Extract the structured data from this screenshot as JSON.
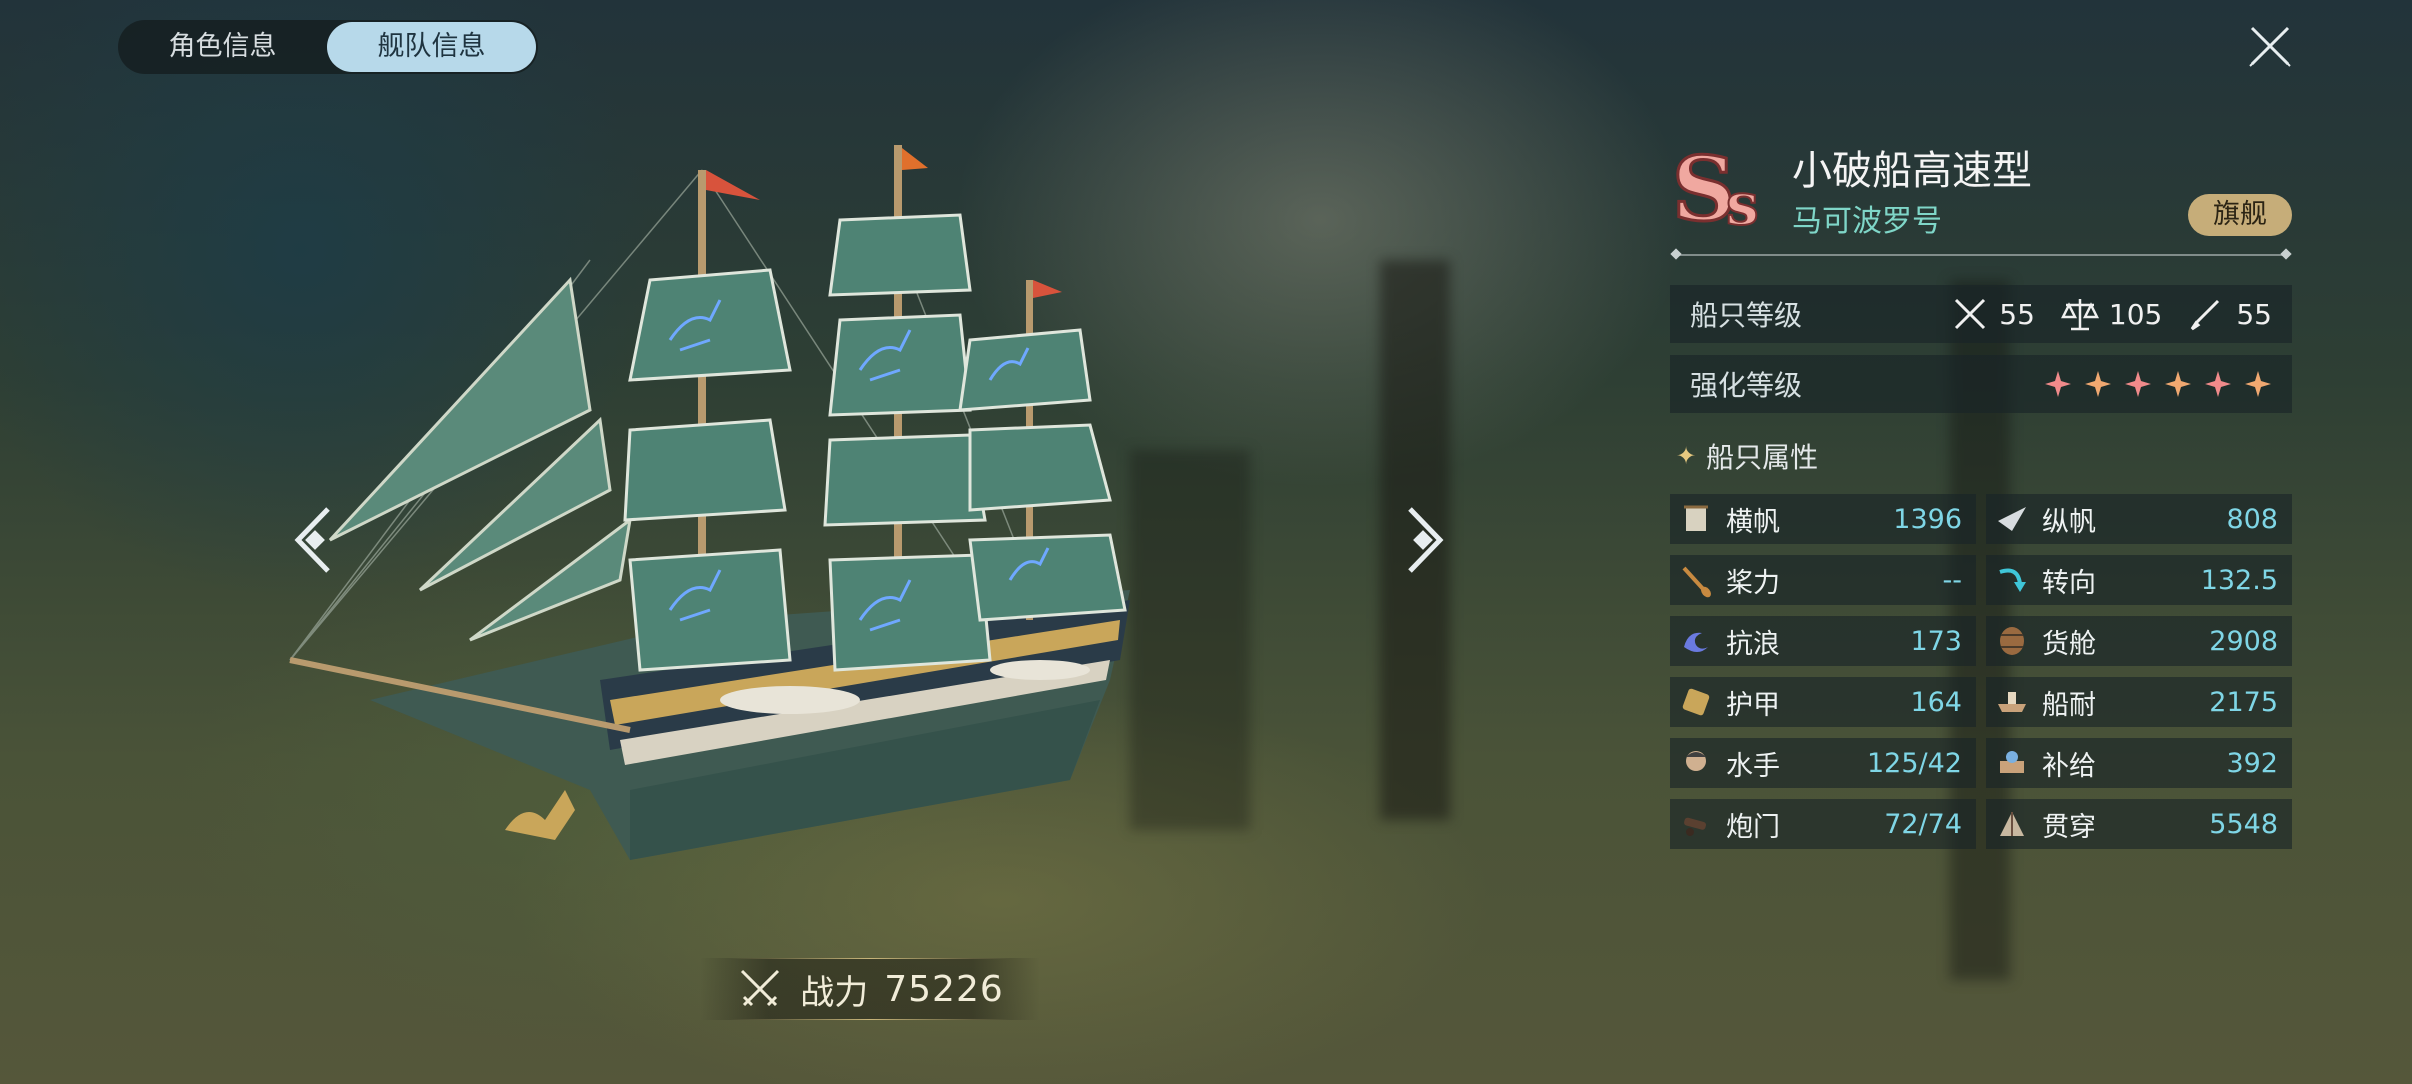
{
  "tabs": [
    {
      "label": "角色信息",
      "active": false
    },
    {
      "label": "舰队信息",
      "active": true
    }
  ],
  "combat_power": {
    "label": "战力",
    "value": "75226"
  },
  "ship": {
    "grade": "Ss",
    "name": "小破船高速型",
    "subtitle": "马可波罗号",
    "flagship_badge": "旗舰"
  },
  "ship_level": {
    "label": "船只等级",
    "attack": "55",
    "balance": "105",
    "craft": "55"
  },
  "enhance_level": {
    "label": "强化等级",
    "stars": 6
  },
  "attributes_title": "船只属性",
  "attributes": [
    {
      "name": "横帆",
      "value": "1396",
      "icon": "square-sail-icon"
    },
    {
      "name": "纵帆",
      "value": "808",
      "icon": "fore-aft-sail-icon"
    },
    {
      "name": "桨力",
      "value": "--",
      "icon": "oar-icon"
    },
    {
      "name": "转向",
      "value": "132.5",
      "icon": "turn-icon"
    },
    {
      "name": "抗浪",
      "value": "173",
      "icon": "wave-icon"
    },
    {
      "name": "货舱",
      "value": "2908",
      "icon": "barrel-icon"
    },
    {
      "name": "护甲",
      "value": "164",
      "icon": "armor-icon"
    },
    {
      "name": "船耐",
      "value": "2175",
      "icon": "hull-icon"
    },
    {
      "name": "水手",
      "value": "125/42",
      "icon": "sailor-icon"
    },
    {
      "name": "补给",
      "value": "392",
      "icon": "supply-icon"
    },
    {
      "name": "炮门",
      "value": "72/74",
      "icon": "cannon-icon"
    },
    {
      "name": "贯穿",
      "value": "5548",
      "icon": "pierce-icon"
    }
  ],
  "colors": {
    "accent_cyan": "#7fd6e6",
    "subtitle_teal": "#7fd6c8",
    "flag_gold": "#c6ad79",
    "star_pink": "#f08a8a",
    "star_orange": "#f0a870"
  }
}
